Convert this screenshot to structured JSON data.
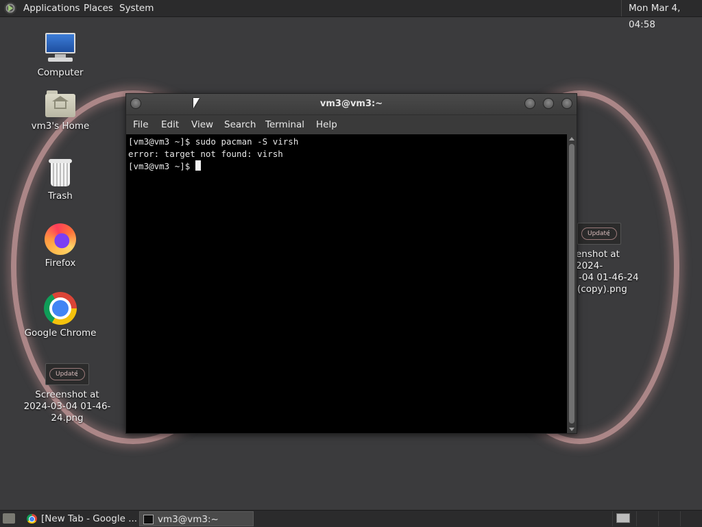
{
  "top_panel": {
    "menus": [
      "Applications",
      "Places",
      "System"
    ],
    "clock": "Mon Mar  4, 04:58"
  },
  "desktop": {
    "icons": [
      {
        "label": "Computer",
        "icon": "computer-icon"
      },
      {
        "label": "vm3's Home",
        "icon": "home-folder-icon"
      },
      {
        "label": "Trash",
        "icon": "trash-icon"
      },
      {
        "label": "Firefox",
        "icon": "firefox-icon"
      },
      {
        "label": "Google Chrome",
        "icon": "chrome-icon"
      },
      {
        "label": "Screenshot at 2024-03-04 01-46-24.png",
        "icon": "image-thumbnail-icon",
        "thumb_text": "Update"
      }
    ],
    "right_file": {
      "label_lines": [
        "enshot at 2024-",
        "-04 01-46-24",
        "(copy).png"
      ],
      "thumb_text": "Update"
    }
  },
  "terminal": {
    "title": "vm3@vm3:~",
    "menu": [
      "File",
      "Edit",
      "View",
      "Search",
      "Terminal",
      "Help"
    ],
    "lines": [
      "[vm3@vm3 ~]$ sudo pacman -S virsh",
      "error: target not found: virsh",
      "[vm3@vm3 ~]$ "
    ]
  },
  "taskbar": {
    "tasks": [
      {
        "label": "[New Tab - Google ...",
        "icon": "chrome-icon"
      },
      {
        "label": "vm3@vm3:~",
        "icon": "terminal-icon",
        "active": true
      }
    ]
  },
  "colors": {
    "panel": "#2b2b2c",
    "desktop": "#3b3b3d",
    "ring": "#d2a0a0",
    "terminal_bg": "#000000"
  }
}
